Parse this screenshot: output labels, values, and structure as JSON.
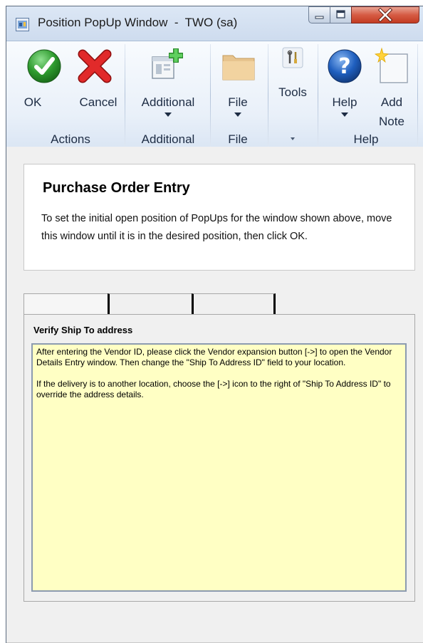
{
  "window": {
    "title": "Position PopUp Window  -  TWO (sa)",
    "controls": {
      "minimize": "minimize-icon",
      "maximize": "maximize-icon",
      "close": "close-icon"
    }
  },
  "ribbon": {
    "buttons": {
      "ok": "OK",
      "cancel": "Cancel",
      "additional": "Additional",
      "file": "File",
      "tools": "Tools",
      "help": "Help",
      "add_note_line1": "Add",
      "add_note_line2": "Note"
    },
    "groups": {
      "actions": "Actions",
      "additional": "Additional",
      "file": "File",
      "help": "Help"
    }
  },
  "info_card": {
    "heading": "Purchase Order Entry",
    "text": "To set the initial open position of PopUps for the window shown above, move this window until it is in the desired position, then click OK."
  },
  "tabs": [
    "",
    "",
    ""
  ],
  "popup_note": {
    "title": "Verify Ship To address",
    "paragraph1": "After entering the Vendor ID, please click the Vendor expansion button [->] to open the Vendor Details Entry window.  Then change the \"Ship To Address ID\" field to your location.",
    "paragraph2": "If the delivery is to another location, choose the [->] icon to the right of \"Ship To Address ID\" to override the address details."
  },
  "colors": {
    "note_background": "#ffffc4",
    "ok_green": "#2e9a2e",
    "cancel_red": "#d32020",
    "help_blue": "#1f5fbf",
    "close_red": "#c33b21"
  }
}
